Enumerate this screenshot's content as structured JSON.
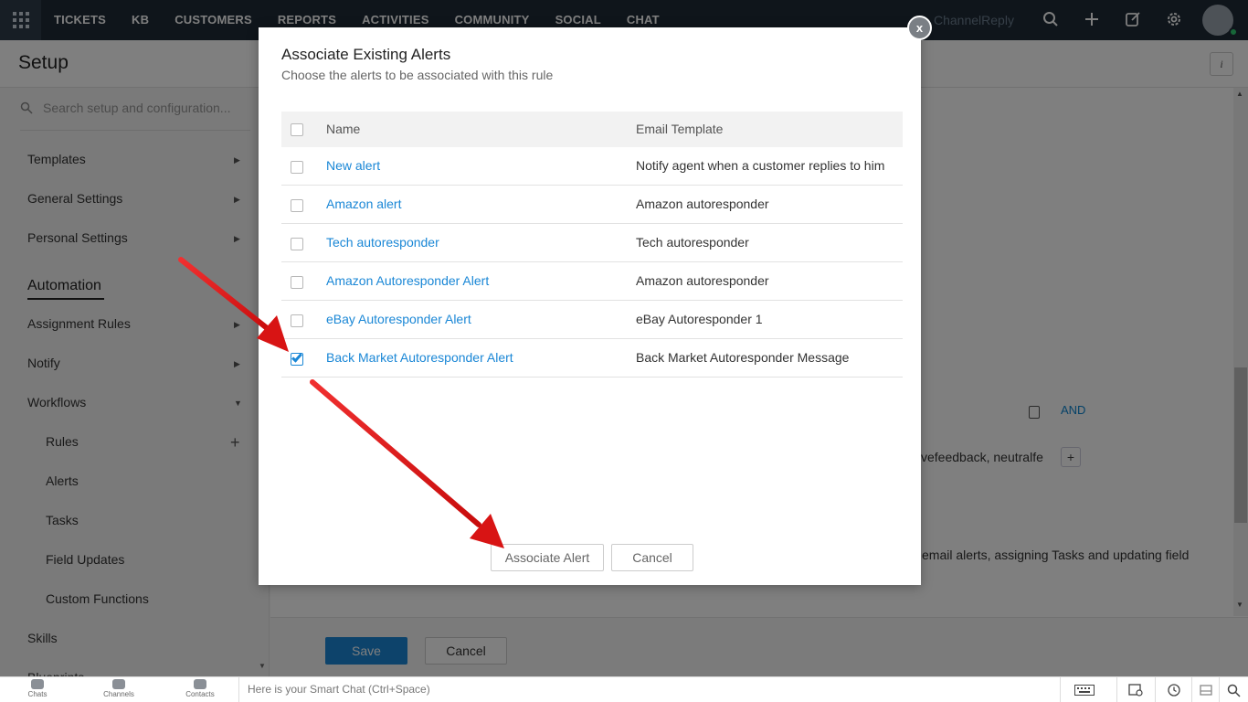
{
  "topnav": {
    "tabs": [
      "TICKETS",
      "KB",
      "CUSTOMERS",
      "REPORTS",
      "ACTIVITIES",
      "COMMUNITY",
      "SOCIAL",
      "CHAT"
    ],
    "brand": "ChannelReply"
  },
  "setup": {
    "title": "Setup",
    "info_label": "i"
  },
  "sidebar": {
    "search_placeholder": "Search setup and configuration...",
    "items": {
      "templates": "Templates",
      "general_settings": "General Settings",
      "personal_settings": "Personal Settings",
      "automation": "Automation",
      "assignment_rules": "Assignment Rules",
      "notify": "Notify",
      "workflows": "Workflows",
      "rules": "Rules",
      "alerts": "Alerts",
      "tasks": "Tasks",
      "field_updates": "Field Updates",
      "custom_functions": "Custom Functions",
      "skills": "Skills",
      "blueprints": "Blueprints"
    }
  },
  "background": {
    "and_label": "AND",
    "field_text": "vefeedback, neutralfe",
    "plus_label": "+",
    "description": "email alerts, assigning Tasks and updating field",
    "save_label": "Save",
    "cancel_label": "Cancel"
  },
  "modal": {
    "title": "Associate Existing Alerts",
    "subtitle": "Choose the alerts to be associated with this rule",
    "close_label": "x",
    "columns": {
      "name": "Name",
      "template": "Email Template"
    },
    "rows": [
      {
        "name": "New alert",
        "template": "Notify agent when a customer replies to him",
        "checked": false
      },
      {
        "name": "Amazon alert",
        "template": "Amazon autoresponder",
        "checked": false
      },
      {
        "name": "Tech autoresponder",
        "template": "Tech autoresponder",
        "checked": false
      },
      {
        "name": "Amazon Autoresponder Alert",
        "template": "Amazon autoresponder",
        "checked": false
      },
      {
        "name": "eBay Autoresponder Alert",
        "template": "eBay Autoresponder 1",
        "checked": false
      },
      {
        "name": "Back Market Autoresponder Alert",
        "template": "Back Market Autoresponder Message",
        "checked": true
      }
    ],
    "associate_label": "Associate Alert",
    "cancel_label": "Cancel"
  },
  "bottombar": {
    "tabs": [
      "Chats",
      "Channels",
      "Contacts"
    ],
    "smartchat_placeholder": "Here is your Smart Chat (Ctrl+Space)"
  },
  "colors": {
    "accent": "#1a87d6",
    "nav_bg": "#1e2a36",
    "arrow": "#e01616"
  }
}
